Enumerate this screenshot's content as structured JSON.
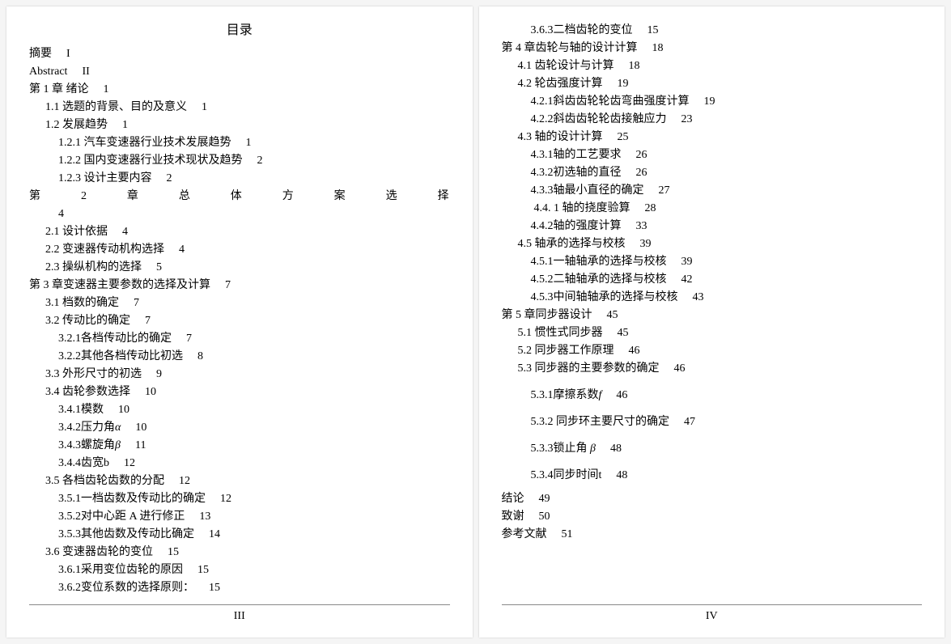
{
  "toc_title": "目录",
  "page_numbers": {
    "left": "III",
    "right": "IV"
  },
  "left": [
    {
      "lvl": 0,
      "text": "摘要",
      "pg": "I"
    },
    {
      "lvl": 0,
      "text": "Abstract",
      "pg": "II"
    },
    {
      "lvl": 0,
      "text": "第 1 章 绪论",
      "pg": "1"
    },
    {
      "lvl": 1,
      "text": "1.1 选题的背景、目的及意义",
      "pg": "1"
    },
    {
      "lvl": 1,
      "text": "1.2 发展趋势",
      "pg": "1"
    },
    {
      "lvl": 2,
      "text": "1.2.1  汽车变速器行业技术发展趋势",
      "pg": "1"
    },
    {
      "lvl": 2,
      "text": "1.2.2  国内变速器行业技术现状及趋势",
      "pg": "2"
    },
    {
      "lvl": 2,
      "text": "1.2.3  设计主要内容",
      "pg": "2"
    },
    {
      "lvl": 0,
      "justified": "第2章总体方案选择",
      "pg": ""
    },
    {
      "lvl": 2,
      "text": "4",
      "pg": ""
    },
    {
      "lvl": 1,
      "text": "2.1 设计依据",
      "pg": "4"
    },
    {
      "lvl": 1,
      "text": "2.2 变速器传动机构选择",
      "pg": "4"
    },
    {
      "lvl": 1,
      "text": "2.3 操纵机构的选择",
      "pg": "5"
    },
    {
      "lvl": 0,
      "text": "第 3 章变速器主要参数的选择及计算",
      "pg": "7"
    },
    {
      "lvl": 1,
      "text": "3.1 档数的确定",
      "pg": "7"
    },
    {
      "lvl": 1,
      "text": "3.2 传动比的确定",
      "pg": "7"
    },
    {
      "lvl": 2,
      "text": "3.2.1各档传动比的确定",
      "pg": "7"
    },
    {
      "lvl": 2,
      "text": "3.2.2其他各档传动比初选",
      "pg": "8"
    },
    {
      "lvl": 1,
      "text": "3.3 外形尺寸的初选",
      "pg": "9"
    },
    {
      "lvl": 1,
      "text": "3.4 齿轮参数选择",
      "pg": "10"
    },
    {
      "lvl": 2,
      "text": "3.4.1模数",
      "pg": "10"
    },
    {
      "lvl": 2,
      "html": "3.4.2压力角<span class='it'>α</span>",
      "pg": "10"
    },
    {
      "lvl": 2,
      "html": "3.4.3螺旋角<span class='it'>β</span>",
      "pg": "11"
    },
    {
      "lvl": 2,
      "text": "3.4.4齿宽b",
      "pg": "12"
    },
    {
      "lvl": 1,
      "text": "3.5 各档齿轮齿数的分配",
      "pg": "12"
    },
    {
      "lvl": 2,
      "text": "3.5.1一档齿数及传动比的确定",
      "pg": "12"
    },
    {
      "lvl": 2,
      "text": "3.5.2对中心距 A 进行修正",
      "pg": "13"
    },
    {
      "lvl": 2,
      "text": "3.5.3其他齿数及传动比确定",
      "pg": "14"
    },
    {
      "lvl": 1,
      "text": "3.6 变速器齿轮的变位",
      "pg": "15"
    },
    {
      "lvl": 2,
      "text": "3.6.1采用变位齿轮的原因",
      "pg": "15"
    },
    {
      "lvl": 2,
      "text": "3.6.2变位系数的选择原则：",
      "pg": "15"
    }
  ],
  "right": [
    {
      "lvl": 2,
      "text": "3.6.3二档齿轮的变位",
      "pg": "15"
    },
    {
      "lvl": 0,
      "text": "第 4 章齿轮与轴的设计计算",
      "pg": "18"
    },
    {
      "lvl": 1,
      "text": "4.1 齿轮设计与计算",
      "pg": "18"
    },
    {
      "lvl": 1,
      "text": "4.2 轮齿强度计算",
      "pg": "19"
    },
    {
      "lvl": 2,
      "text": "4.2.1斜齿齿轮轮齿弯曲强度计算",
      "pg": "19"
    },
    {
      "lvl": 2,
      "text": "4.2.2斜齿齿轮轮齿接触应力",
      "pg": "23"
    },
    {
      "lvl": 1,
      "text": "4.3 轴的设计计算",
      "pg": "25"
    },
    {
      "lvl": 2,
      "text": "4.3.1轴的工艺要求",
      "pg": "26"
    },
    {
      "lvl": 2,
      "text": "4.3.2初选轴的直径",
      "pg": "26"
    },
    {
      "lvl": 2,
      "text": "4.3.3轴最小直径的确定",
      "pg": "27"
    },
    {
      "lvl": 3,
      "text": "4.4. 1 轴的挠度验算",
      "pg": "28"
    },
    {
      "lvl": 2,
      "text": "4.4.2轴的强度计算",
      "pg": "33"
    },
    {
      "lvl": 1,
      "text": "4.5 轴承的选择与校核",
      "pg": "39"
    },
    {
      "lvl": 2,
      "text": "4.5.1一轴轴承的选择与校核",
      "pg": "39"
    },
    {
      "lvl": 2,
      "text": "4.5.2二轴轴承的选择与校核",
      "pg": "42"
    },
    {
      "lvl": 2,
      "text": "4.5.3中间轴轴承的选择与校核",
      "pg": "43"
    },
    {
      "lvl": 0,
      "text": "第 5 章同步器设计",
      "pg": "45"
    },
    {
      "lvl": 1,
      "text": "5.1 惯性式同步器",
      "pg": "45"
    },
    {
      "lvl": 1,
      "text": "5.2 同步器工作原理",
      "pg": "46"
    },
    {
      "lvl": 1,
      "text": "5.3 同步器的主要参数的确定",
      "pg": "46"
    },
    {
      "lvl": 2,
      "spacer": true,
      "html": "5.3.1摩擦系数<span class='it'>f</span>",
      "pg": "46"
    },
    {
      "lvl": 2,
      "spacer": true,
      "text": "5.3.2  同步环主要尺寸的确定",
      "pg": "47"
    },
    {
      "lvl": 2,
      "spacer": true,
      "html": "5.3.3锁止角<span class='it'> β</span>",
      "pg": "48"
    },
    {
      "lvl": 2,
      "spacer": true,
      "text": "5.3.4同步时间t",
      "pg": "48"
    },
    {
      "lvl": 0,
      "text": "结论",
      "pg": "49"
    },
    {
      "lvl": 0,
      "text": "致谢",
      "pg": "50"
    },
    {
      "lvl": 0,
      "text": "参考文献",
      "pg": "51"
    }
  ]
}
